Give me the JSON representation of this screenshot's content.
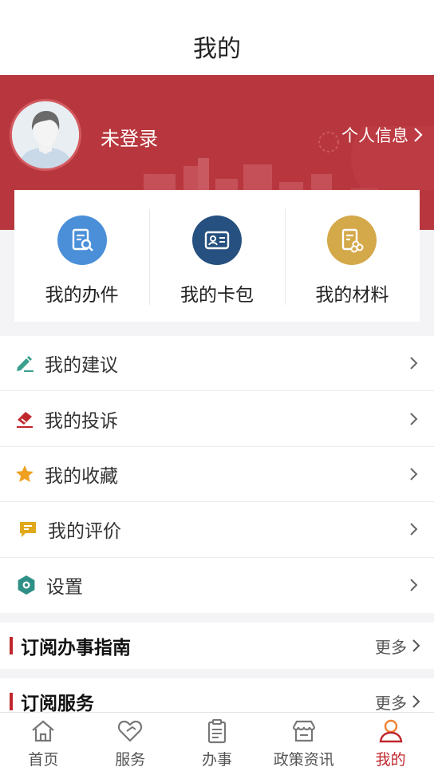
{
  "header": {
    "title": "我的"
  },
  "profile": {
    "login_status": "未登录",
    "info_link": "个人信息"
  },
  "quick_actions": [
    {
      "label": "我的办件",
      "icon": "search-document-icon",
      "color": "#4a8fd8"
    },
    {
      "label": "我的卡包",
      "icon": "id-card-icon",
      "color": "#26507f"
    },
    {
      "label": "我的材料",
      "icon": "materials-icon",
      "color": "#d4a94a"
    }
  ],
  "menu": [
    {
      "label": "我的建议",
      "icon": "edit-pen-icon",
      "color": "#3aa08d"
    },
    {
      "label": "我的投诉",
      "icon": "complaint-icon",
      "color": "#c0272d"
    },
    {
      "label": "我的收藏",
      "icon": "star-icon",
      "color": "#f0a020"
    },
    {
      "label": "我的评价",
      "icon": "comment-icon",
      "color": "#e0a91c"
    },
    {
      "label": "设置",
      "icon": "gear-icon",
      "color": "#2e8f86"
    }
  ],
  "sections": [
    {
      "title": "订阅办事指南",
      "more": "更多"
    },
    {
      "title": "订阅服务",
      "more": "更多"
    }
  ],
  "tabs": [
    {
      "label": "首页",
      "icon": "home-icon",
      "active": false
    },
    {
      "label": "服务",
      "icon": "heart-service-icon",
      "active": false
    },
    {
      "label": "办事",
      "icon": "clipboard-icon",
      "active": false
    },
    {
      "label": "政策资讯",
      "icon": "store-icon",
      "active": false
    },
    {
      "label": "我的",
      "icon": "user-icon",
      "active": true
    }
  ],
  "colors": {
    "accent": "#c0272d",
    "hero": "#b8373e"
  }
}
